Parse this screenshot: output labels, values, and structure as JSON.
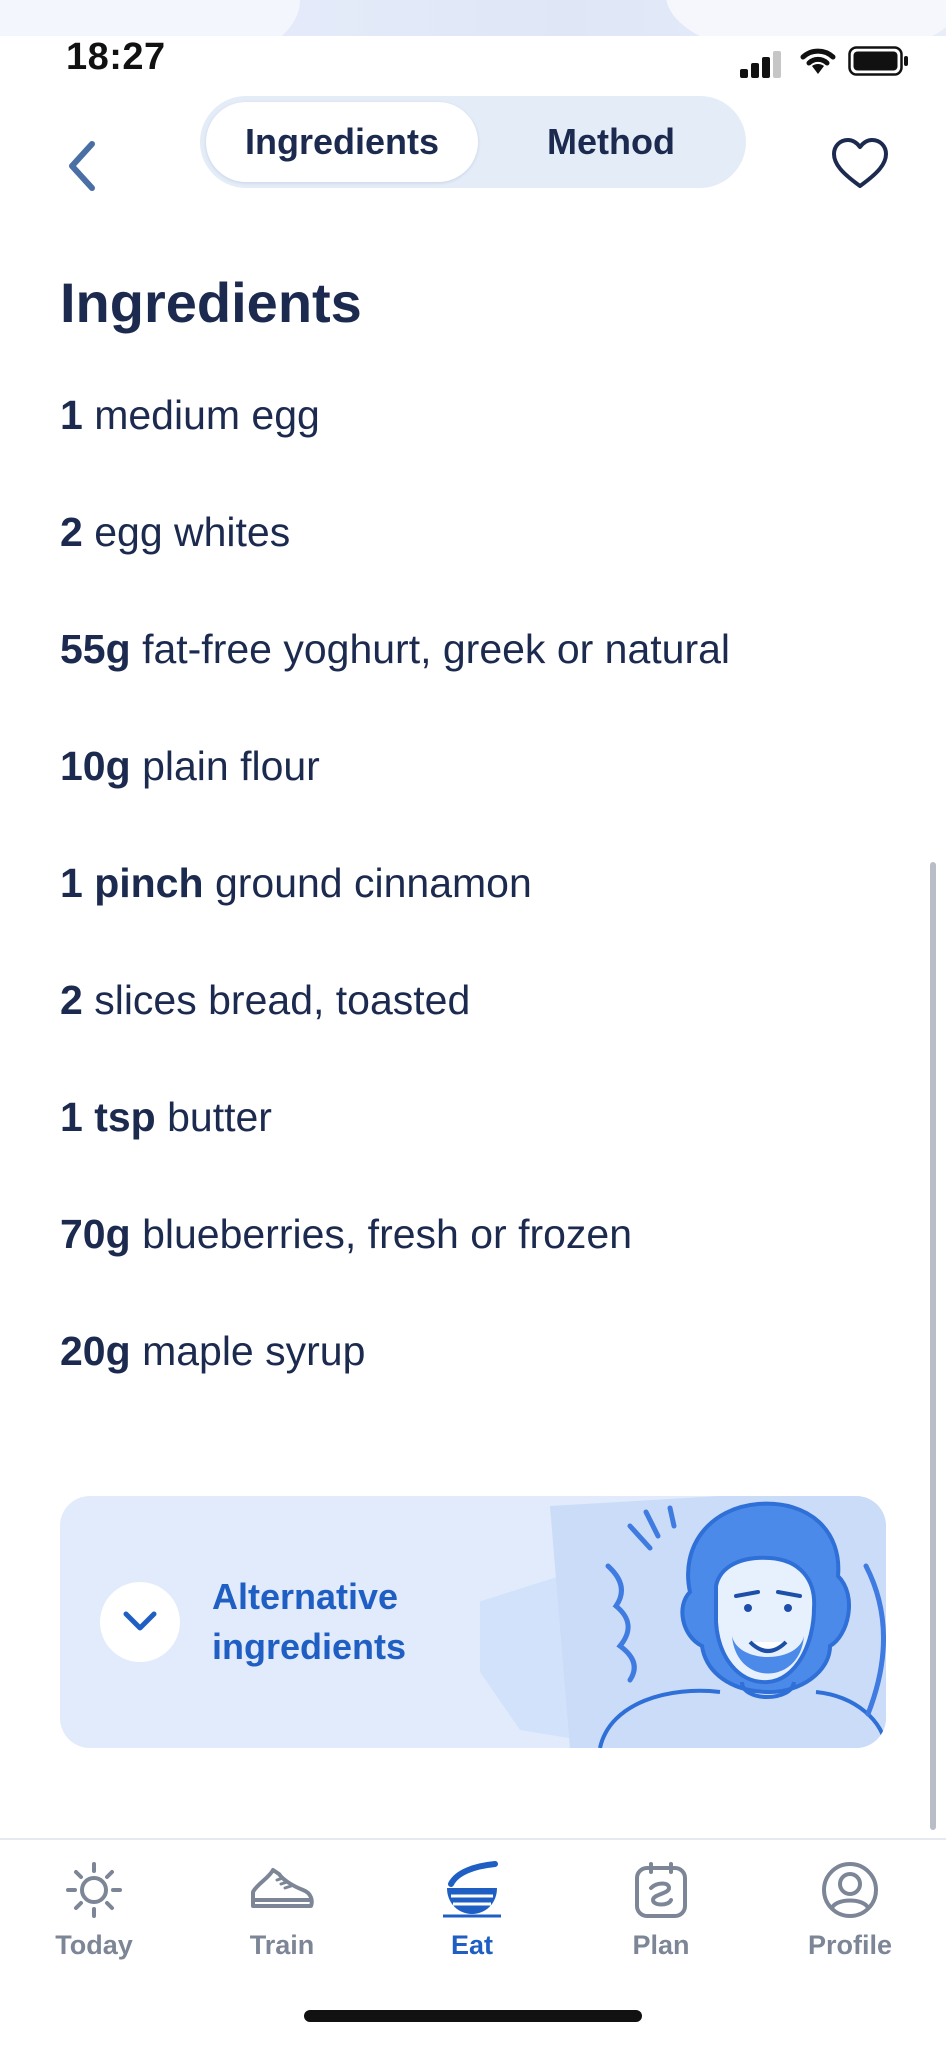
{
  "status_bar": {
    "time": "18:27"
  },
  "header": {
    "tabs": [
      {
        "label": "Ingredients",
        "active": true
      },
      {
        "label": "Method",
        "active": false
      }
    ]
  },
  "section": {
    "title": "Ingredients"
  },
  "ingredients": [
    {
      "qty": "1",
      "name": "medium egg"
    },
    {
      "qty": "2",
      "name": "egg whites"
    },
    {
      "qty": "55g",
      "name": "fat-free yoghurt, greek or natural"
    },
    {
      "qty": "10g",
      "name": "plain flour"
    },
    {
      "qty": "1 pinch",
      "name": "ground cinnamon"
    },
    {
      "qty": "2",
      "name": "slices bread, toasted"
    },
    {
      "qty": "1 tsp",
      "name": "butter"
    },
    {
      "qty": "70g",
      "name": "blueberries, fresh or frozen"
    },
    {
      "qty": "20g",
      "name": "maple syrup"
    }
  ],
  "alternative": {
    "line1": "Alternative",
    "line2": "ingredients"
  },
  "tab_bar": {
    "tabs": [
      {
        "label": "Today",
        "icon": "sun-icon",
        "active": false
      },
      {
        "label": "Train",
        "icon": "shoe-icon",
        "active": false
      },
      {
        "label": "Eat",
        "icon": "bowl-icon",
        "active": true
      },
      {
        "label": "Plan",
        "icon": "calendar-icon",
        "active": false
      },
      {
        "label": "Profile",
        "icon": "profile-icon",
        "active": false
      }
    ]
  },
  "colors": {
    "accent": "#1f5fc4",
    "text": "#1b2a4e",
    "muted": "#7d8696",
    "segment_bg": "#e4ecf8",
    "card_bg": "#e1ebfb",
    "illustration": "#4b8ae8"
  }
}
